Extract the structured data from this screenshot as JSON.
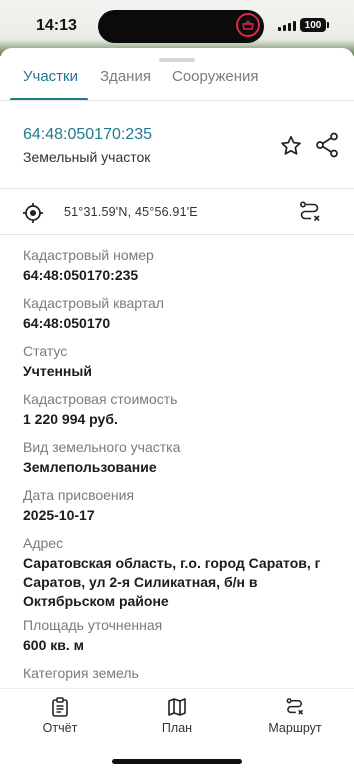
{
  "status_bar": {
    "time": "14:13",
    "battery": "100"
  },
  "tabs": [
    {
      "label": "Участки",
      "active": true
    },
    {
      "label": "Здания",
      "active": false
    },
    {
      "label": "Сооружения",
      "active": false
    }
  ],
  "parcel": {
    "id": "64:48:050170:235",
    "type": "Земельный участок"
  },
  "coordinates": "51°31.59'N, 45°56.91'E",
  "fields": [
    {
      "label": "Кадастровый номер",
      "value": "64:48:050170:235"
    },
    {
      "label": "Кадастровый квартал",
      "value": "64:48:050170"
    },
    {
      "label": "Статус",
      "value": "Учтенный"
    },
    {
      "label": "Кадастровая стоимость",
      "value": "1 220 994 руб."
    },
    {
      "label": "Вид земельного участка",
      "value": "Землепользование"
    },
    {
      "label": "Дата присвоения",
      "value": "2025-10-17"
    },
    {
      "label": "Адрес",
      "value": "Саратовская область, г.о. город Саратов, г Саратов, ул 2-я Силикатная, б/н в Октябрьском районе"
    },
    {
      "label": "Площадь уточненная",
      "value": "600 кв. м"
    },
    {
      "label": "Категория земель",
      "value": ""
    }
  ],
  "bottom_nav": [
    {
      "label": "Отчёт",
      "icon": "clipboard-icon"
    },
    {
      "label": "План",
      "icon": "map-icon"
    },
    {
      "label": "Маршрут",
      "icon": "route-icon"
    }
  ],
  "colors": {
    "accent": "#1f7a8c",
    "label_gray": "#7b7b7b",
    "record_indicator": "#e0264a"
  }
}
